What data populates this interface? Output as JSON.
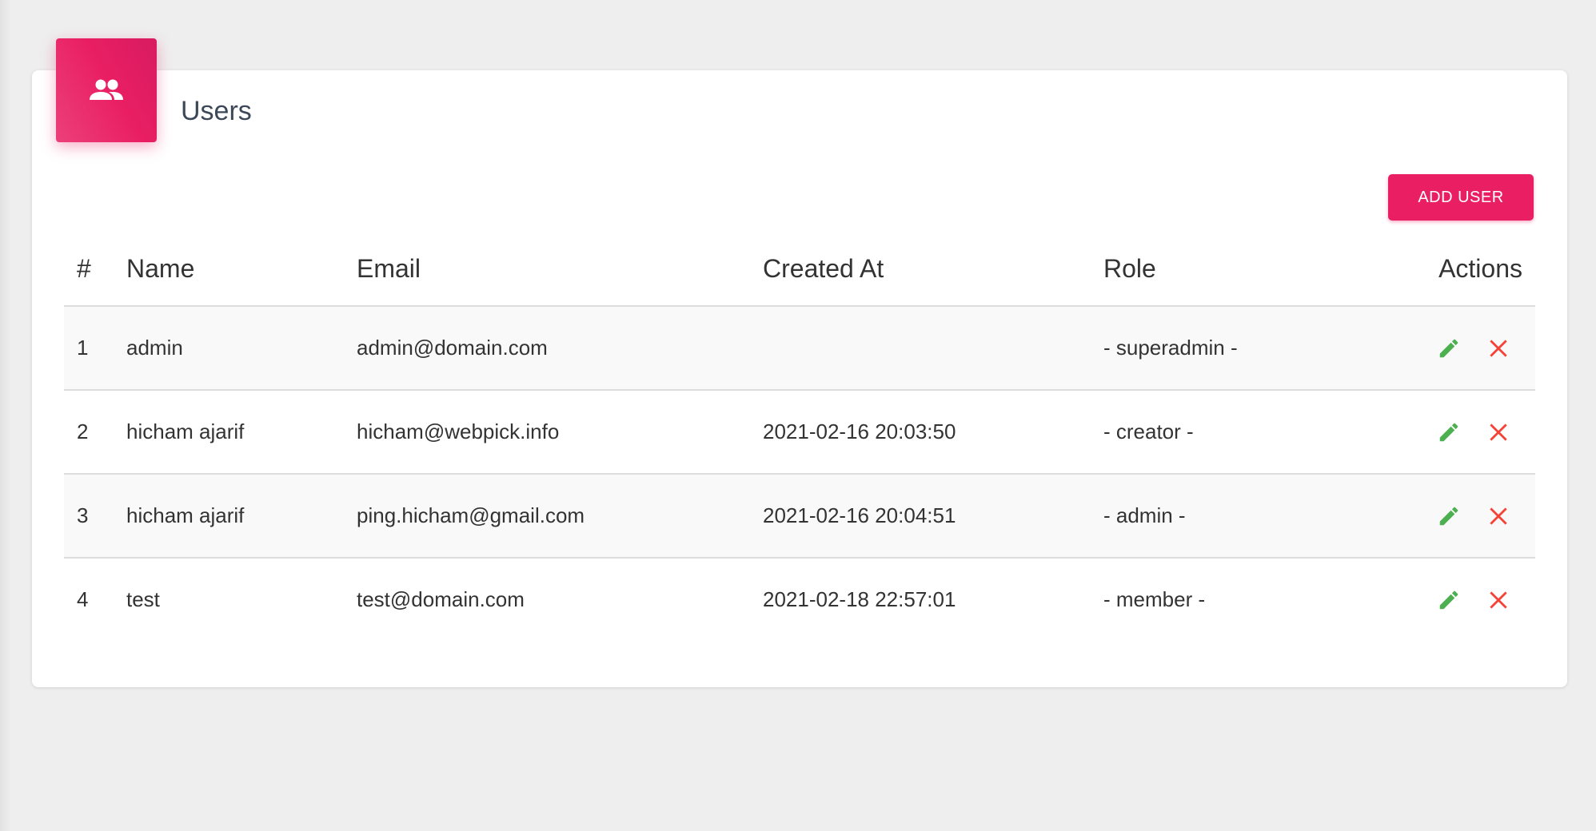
{
  "card": {
    "title": "Users",
    "header_icon": "people-icon",
    "accent_color": "#e91e63"
  },
  "toolbar": {
    "add_user_label": "ADD USER"
  },
  "table": {
    "columns": [
      "#",
      "Name",
      "Email",
      "Created At",
      "Role",
      "Actions"
    ],
    "rows": [
      {
        "num": "1",
        "name": "admin",
        "email": "admin@domain.com",
        "created_at": "",
        "role": "- superadmin -"
      },
      {
        "num": "2",
        "name": "hicham ajarif",
        "email": "hicham@webpick.info",
        "created_at": "2021-02-16 20:03:50",
        "role": "- creator -"
      },
      {
        "num": "3",
        "name": "hicham ajarif",
        "email": "ping.hicham@gmail.com",
        "created_at": "2021-02-16 20:04:51",
        "role": "- admin -"
      },
      {
        "num": "4",
        "name": "test",
        "email": "test@domain.com",
        "created_at": "2021-02-18 22:57:01",
        "role": "- member -"
      }
    ],
    "action_icons": {
      "edit": "pencil-icon",
      "delete": "close-icon",
      "edit_color": "#4caf50",
      "delete_color": "#f44336"
    }
  }
}
